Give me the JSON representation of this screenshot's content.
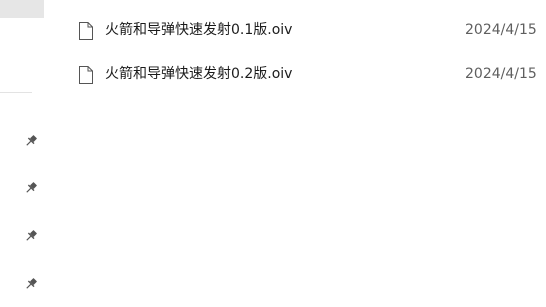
{
  "nav": {
    "pinned_icon": "pin-icon"
  },
  "files": [
    {
      "icon": "file-icon",
      "name": "火箭和导弹快速发射0.1版.oiv",
      "date": "2024/4/15"
    },
    {
      "icon": "file-icon",
      "name": "火箭和导弹快速发射0.2版.oiv",
      "date": "2024/4/15"
    }
  ],
  "colors": {
    "selected_bg": "#e6e6e6",
    "text": "#1b1b1b",
    "secondary_text": "#5f5f5f",
    "icon_stroke": "#555555"
  }
}
